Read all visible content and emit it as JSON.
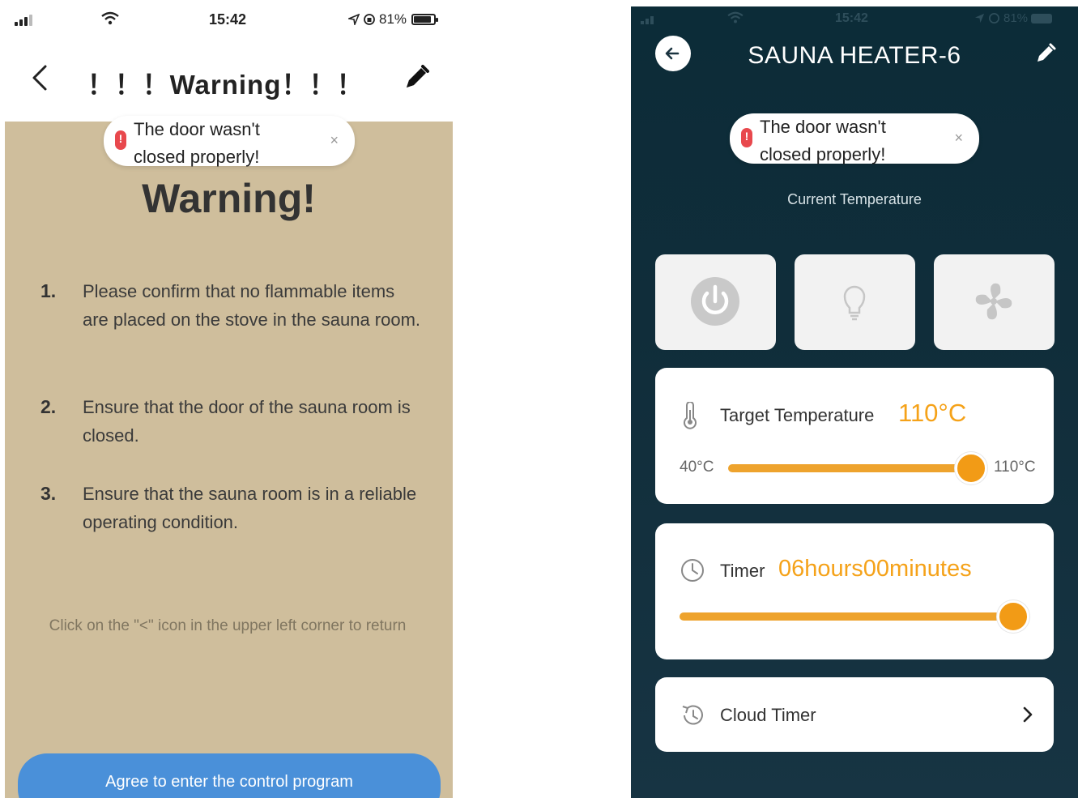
{
  "left_screen": {
    "status_bar": {
      "time": "15:42",
      "battery": "81%"
    },
    "header": {
      "title": "！！！Warning！！！"
    },
    "toast": {
      "message": "The door wasn't closed properly!",
      "close": "×"
    },
    "heading": "Warning!",
    "steps": [
      {
        "number": "1.",
        "text": "Please confirm that no flammable items are placed on the stove in the sauna room."
      },
      {
        "number": "2.",
        "text": "Ensure that the door of the sauna room is closed."
      },
      {
        "number": "3.",
        "text": "Ensure that the sauna room is in a reliable operating condition."
      }
    ],
    "hint": "Click on the \"<\" icon in the upper left corner to return",
    "agree_button": "Agree to enter the control program"
  },
  "right_screen": {
    "status_bar": {
      "time": "15:42",
      "battery": "81%"
    },
    "header": {
      "title": "SAUNA HEATER-6"
    },
    "toast": {
      "message": "The door wasn't closed properly!",
      "close": "×"
    },
    "current_temperature_label": "Current Temperature",
    "controls": [
      {
        "name": "power",
        "icon": "power-icon"
      },
      {
        "name": "light",
        "icon": "bulb-icon"
      },
      {
        "name": "fan",
        "icon": "fan-icon"
      }
    ],
    "target_temperature": {
      "label": "Target Temperature",
      "value": "110°C",
      "min": "40°C",
      "max": "110°C",
      "level": 1.0
    },
    "timer": {
      "label": "Timer",
      "value": "06hours00minutes",
      "level": 1.0
    },
    "cloud_timer": {
      "label": "Cloud Timer"
    }
  },
  "colors": {
    "accent": "#f29b16",
    "warning_bg": "#cfbe9c",
    "dark_bg": "#0f2c38",
    "alert": "#e8484d",
    "agree_button": "#4a90d9"
  }
}
